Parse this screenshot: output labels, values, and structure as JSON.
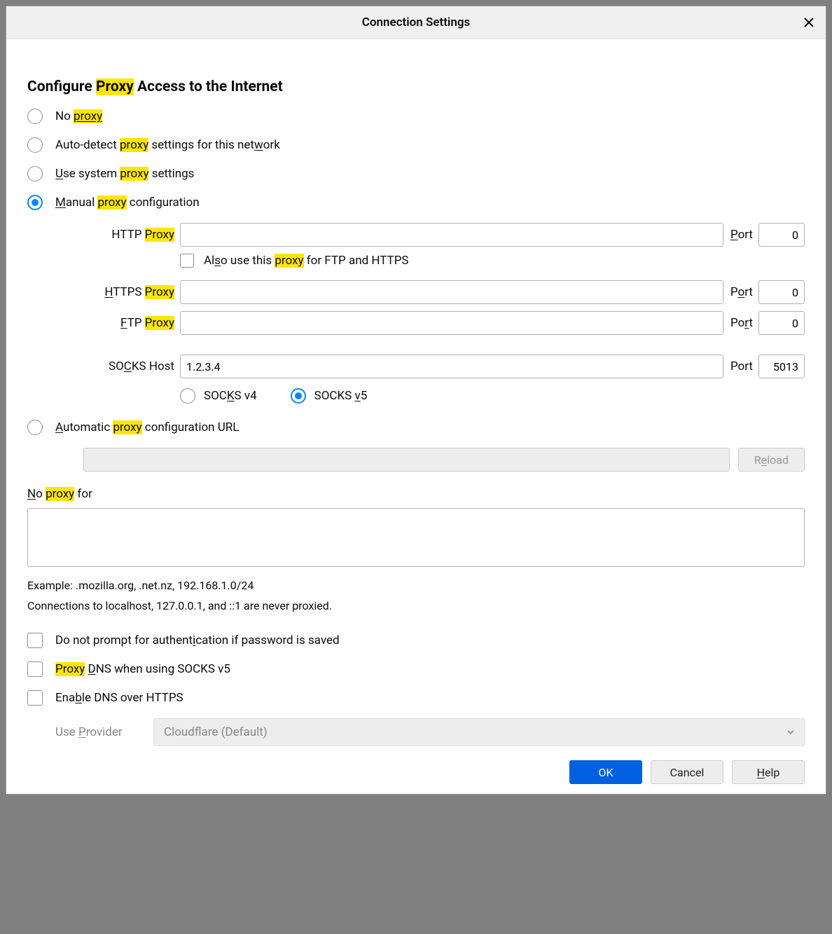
{
  "dialog": {
    "title": "Connection Settings",
    "heading_pre": "Configure ",
    "heading_hl": "Proxy",
    "heading_post": " Access to the Internet"
  },
  "radios": {
    "no_proxy_pre": "No ",
    "no_proxy_hl": "proxy",
    "autodetect_pre": "Auto-detect ",
    "autodetect_hl": "proxy",
    "autodetect_post": " settings for this net",
    "autodetect_u": "w",
    "autodetect_end": "ork",
    "system_u": "U",
    "system_mid": "se system ",
    "system_hl": "proxy",
    "system_post": " settings",
    "manual_u": "M",
    "manual_mid": "anual ",
    "manual_hl": "proxy",
    "manual_post": " configuration",
    "auto_url_u": "A",
    "auto_url_mid": "utomatic ",
    "auto_url_hl": "proxy",
    "auto_url_post": " configuration URL"
  },
  "fields": {
    "http_label_pre": "HTTP ",
    "http_label_hl": "Proxy",
    "http_value": "",
    "http_port_label_u": "P",
    "http_port_label_post": "ort",
    "http_port": "0",
    "also_use_pre": "Al",
    "also_use_u": "s",
    "also_use_mid": "o use this ",
    "also_use_hl": "proxy",
    "also_use_post": " for FTP and HTTPS",
    "https_label_u": "H",
    "https_label_mid": "TTPS ",
    "https_label_hl": "Proxy",
    "https_value": "",
    "https_port_label_pre": "P",
    "https_port_label_u": "o",
    "https_port_label_post": "rt",
    "https_port": "0",
    "ftp_label_u": "F",
    "ftp_label_mid": "TP ",
    "ftp_label_hl": "Proxy",
    "ftp_value": "",
    "ftp_port_label_pre": "Po",
    "ftp_port_label_u": "r",
    "ftp_port_label_post": "t",
    "ftp_port": "0",
    "socks_label_pre": "SO",
    "socks_label_u": "C",
    "socks_label_post": "KS Host",
    "socks_value": "1.2.3.4",
    "socks_port_label": "Port",
    "socks_port": "5013",
    "socks_v4_pre": "SOC",
    "socks_v4_u": "K",
    "socks_v4_post": "S v4",
    "socks_v5_pre": "SOCKS ",
    "socks_v5_u": "v",
    "socks_v5_post": "5"
  },
  "noproxy": {
    "label_u": "N",
    "label_mid": "o ",
    "label_hl": "proxy",
    "label_post": " for",
    "value": "",
    "example": "Example: .mozilla.org, .net.nz, 192.168.1.0/24",
    "note": "Connections to localhost, 127.0.0.1, and ::1 are never proxied."
  },
  "checks": {
    "noauth_pre": "Do not prompt for authent",
    "noauth_u": "i",
    "noauth_post": "cation if password is saved",
    "proxydns_hl": "Proxy",
    "proxydns_mid": " ",
    "proxydns_u": "D",
    "proxydns_post": "NS when using SOCKS v5",
    "doh_pre": "Ena",
    "doh_u": "b",
    "doh_post": "le DNS over HTTPS"
  },
  "provider": {
    "label_pre": "Use ",
    "label_u": "P",
    "label_post": "rovider",
    "selected": "Cloudflare (Default)"
  },
  "buttons": {
    "reload_pre": "R",
    "reload_u": "e",
    "reload_post": "load",
    "ok": "OK",
    "cancel": "Cancel",
    "help_u": "H",
    "help_post": "elp"
  }
}
